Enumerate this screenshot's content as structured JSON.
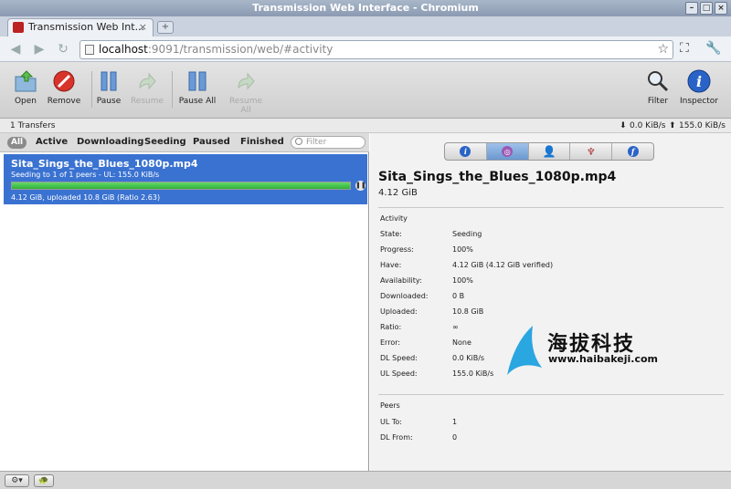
{
  "window": {
    "title": "Transmission Web Interface - Chromium"
  },
  "browser": {
    "tab_title": "Transmission Web Int...",
    "tab_close": "×",
    "new_tab": "+",
    "url_host": "localhost",
    "url_path": ":9091/transmission/web/#activity"
  },
  "toolbar": {
    "open": "Open",
    "remove": "Remove",
    "pause": "Pause",
    "resume": "Resume",
    "pause_all": "Pause All",
    "resume_all": "Resume All",
    "filter": "Filter",
    "inspector": "Inspector"
  },
  "status": {
    "transfers": "1 Transfers",
    "down_speed": "0.0 KiB/s",
    "up_speed": "155.0 KiB/s"
  },
  "filters": {
    "all": "All",
    "active": "Active",
    "downloading": "Downloading",
    "seeding": "Seeding",
    "paused": "Paused",
    "finished": "Finished",
    "search_placeholder": "Filter"
  },
  "torrent": {
    "name": "Sita_Sings_the_Blues_1080p.mp4",
    "peers_line": "Seeding to 1 of 1 peers - UL: 155.0 KiB/s",
    "progress": 1.0,
    "details_line": "4.12 GiB, uploaded 10.8 GiB (Ratio 2.63)"
  },
  "inspector": {
    "title": "Sita_Sings_the_Blues_1080p.mp4",
    "size": "4.12 GiB",
    "activity_heading": "Activity",
    "activity": [
      {
        "k": "State:",
        "v": "Seeding"
      },
      {
        "k": "Progress:",
        "v": "100%"
      },
      {
        "k": "Have:",
        "v": "4.12 GiB (4.12 GiB verified)"
      },
      {
        "k": "Availability:",
        "v": "100%"
      },
      {
        "k": "Downloaded:",
        "v": "0 B"
      },
      {
        "k": "Uploaded:",
        "v": "10.8 GiB"
      },
      {
        "k": "Ratio:",
        "v": "∞"
      },
      {
        "k": "Error:",
        "v": "None"
      },
      {
        "k": "DL Speed:",
        "v": "0.0 KiB/s"
      },
      {
        "k": "UL Speed:",
        "v": "155.0 KiB/s"
      }
    ],
    "peers_heading": "Peers",
    "peers": [
      {
        "k": "UL To:",
        "v": "1"
      },
      {
        "k": "DL From:",
        "v": "0"
      }
    ]
  },
  "watermark": {
    "chinese": "海拔科技",
    "url": "www.haibakeji.com"
  },
  "colors": {
    "selection": "#3a72d1",
    "progress": "#2fb138",
    "watermark_sail": "#2aa6e0"
  }
}
